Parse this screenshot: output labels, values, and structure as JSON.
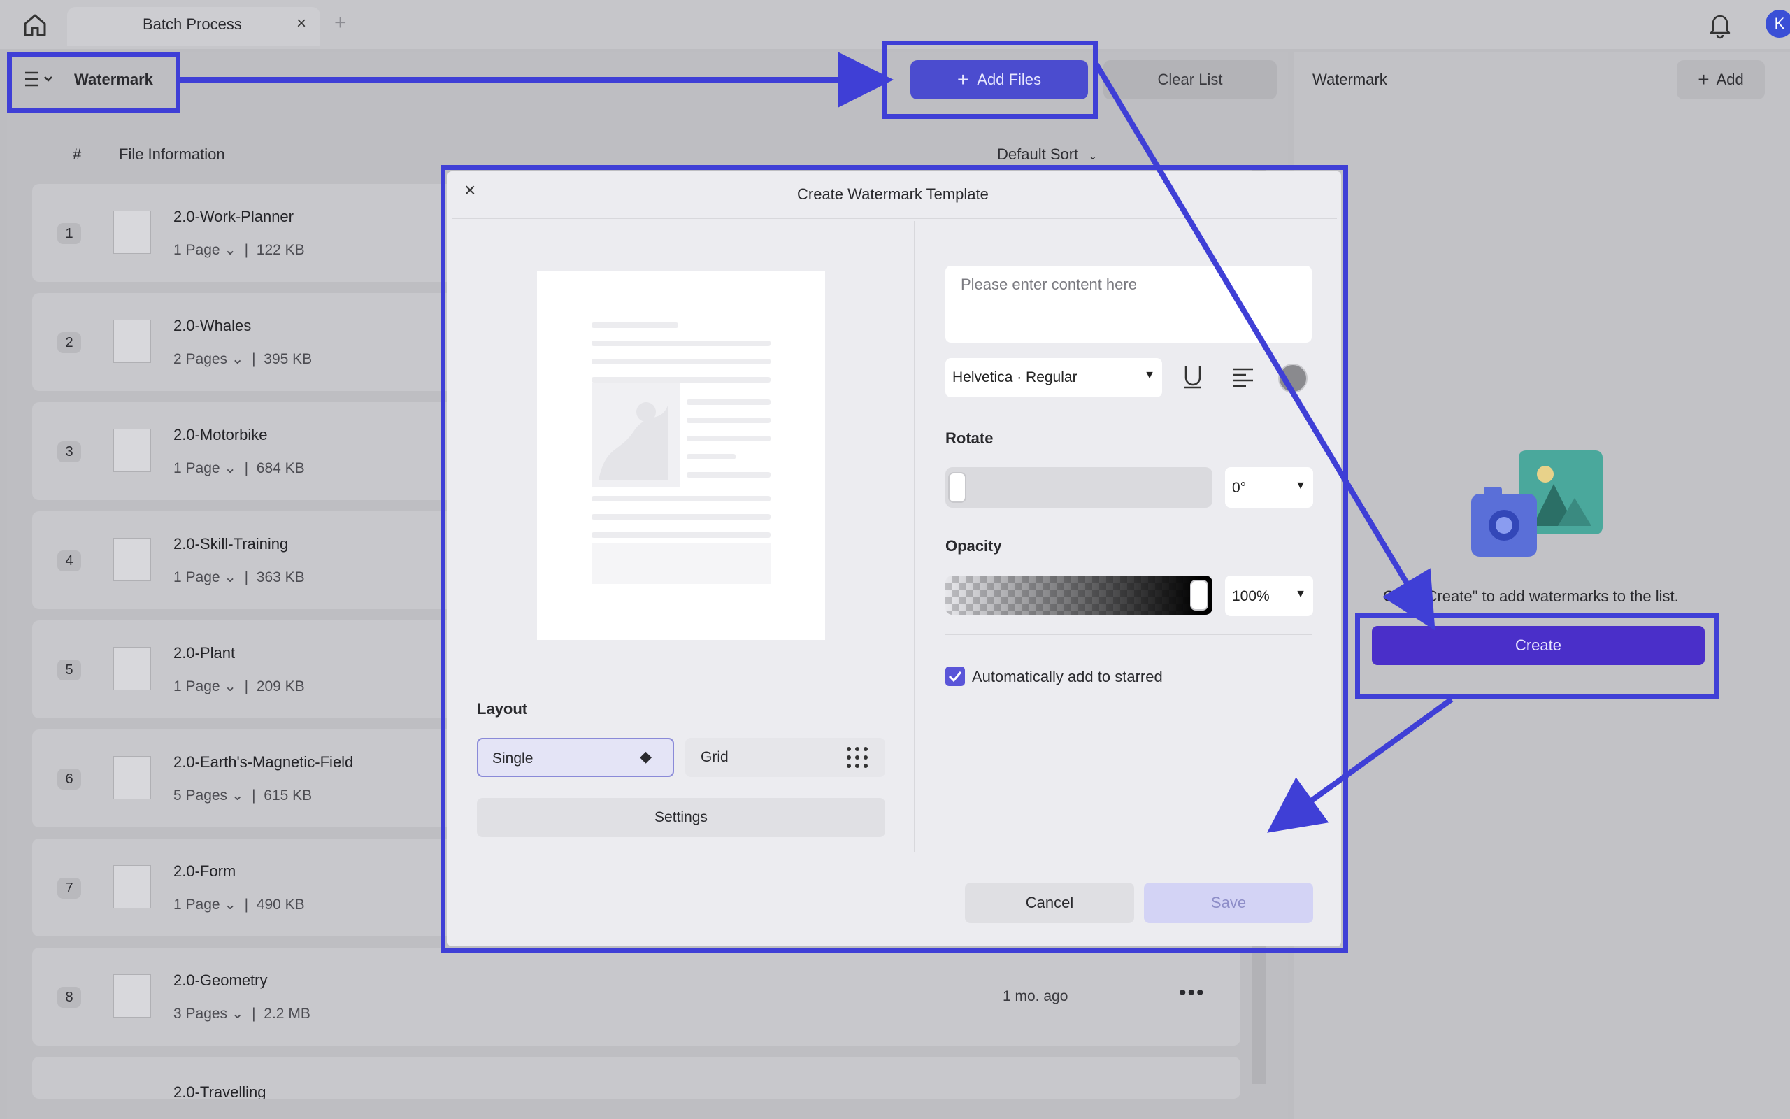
{
  "tab": {
    "title": "Batch Process",
    "close": "×",
    "plus": "+"
  },
  "user": {
    "avatar": "K"
  },
  "toolbar": {
    "mode": "Watermark",
    "add_files": "Add Files",
    "clear_list": "Clear List"
  },
  "list": {
    "col_num": "#",
    "col_info": "File Information",
    "sort": "Default Sort",
    "rows": [
      {
        "num": "1",
        "name": "2.0-Work-Planner",
        "pages": "1 Page",
        "size": "122 KB"
      },
      {
        "num": "2",
        "name": "2.0-Whales",
        "pages": "2 Pages",
        "size": "395 KB"
      },
      {
        "num": "3",
        "name": "2.0-Motorbike",
        "pages": "1 Page",
        "size": "684 KB"
      },
      {
        "num": "4",
        "name": "2.0-Skill-Training",
        "pages": "1 Page",
        "size": "363 KB"
      },
      {
        "num": "5",
        "name": "2.0-Plant",
        "pages": "1 Page",
        "size": "209 KB"
      },
      {
        "num": "6",
        "name": "2.0-Earth's-Magnetic-Field",
        "pages": "5 Pages",
        "size": "615 KB"
      },
      {
        "num": "7",
        "name": "2.0-Form",
        "pages": "1 Page",
        "size": "490 KB"
      },
      {
        "num": "8",
        "name": "2.0-Geometry",
        "pages": "3 Pages",
        "size": "2.2 MB",
        "time": "1 mo. ago"
      },
      {
        "num": "",
        "name": "2.0-Travelling",
        "pages": "",
        "size": ""
      }
    ]
  },
  "modal": {
    "title": "Create Watermark Template",
    "close": "×",
    "content_placeholder": "Please enter content here",
    "font": "Helvetica · Regular",
    "rotate_label": "Rotate",
    "rotate_value": "0°",
    "rotate_level": 0,
    "opacity_label": "Opacity",
    "opacity_value": "100%",
    "opacity_level": 1.0,
    "starred_label": "Automatically add to starred",
    "starred_checked": true,
    "layout_label": "Layout",
    "layout_single": "Single",
    "layout_grid": "Grid",
    "settings": "Settings",
    "cancel": "Cancel",
    "save": "Save"
  },
  "right": {
    "title": "Watermark",
    "add": "Add",
    "empty_text": "Click \"Create\" to add watermarks to the list.",
    "create": "Create"
  },
  "colors": {
    "accent": "#4b4ccf",
    "highlight": "#3f3fd6",
    "create": "#4a2fc9"
  }
}
